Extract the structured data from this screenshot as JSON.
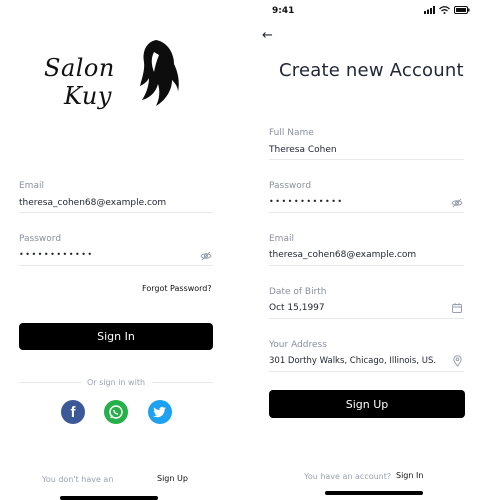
{
  "login": {
    "logo_line1": "Salon",
    "logo_line2": "Kuy",
    "email_label": "Email",
    "email_value": "theresa_cohen68@example.com",
    "password_label": "Password",
    "password_mask": "••••••••••••",
    "forgot_label": "Forgot Password?",
    "signin_button": "Sign In",
    "or_sign_in_with": "Or sign in with",
    "no_account_text": "You don't have an",
    "signup_link": "Sign Up",
    "social": [
      "facebook",
      "whatsapp",
      "twitter"
    ],
    "colors": {
      "facebook": "#3b5998",
      "whatsapp": "#25b04a",
      "twitter": "#1da1f2"
    }
  },
  "signup": {
    "status_time": "9:41",
    "title": "Create new Account",
    "full_name_label": "Full Name",
    "full_name_value": "Theresa Cohen",
    "password_label": "Password",
    "password_mask": "••••••••••••",
    "email_label": "Email",
    "email_value": "theresa_cohen68@example.com",
    "dob_label": "Date of Birth",
    "dob_value": "Oct 15,1997",
    "address_label": "Your Address",
    "address_value": "301 Dorthy Walks, Chicago, Illinois, US.",
    "signup_button": "Sign Up",
    "have_account_text": "You have an account?",
    "signin_link": "Sign In"
  }
}
